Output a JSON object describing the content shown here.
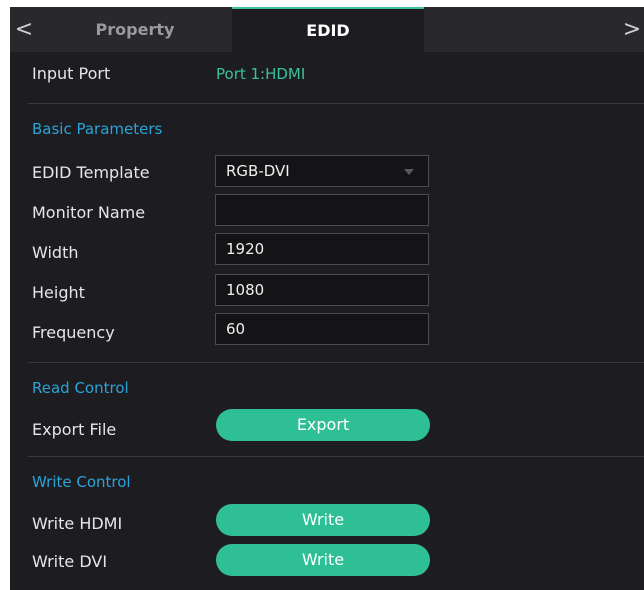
{
  "tabs": {
    "left_arrow": "<",
    "right_arrow": ">",
    "property": "Property",
    "edid": "EDID"
  },
  "input_port": {
    "label": "Input Port",
    "value": "Port 1:HDMI"
  },
  "basic": {
    "title": "Basic Parameters",
    "edid_template": {
      "label": "EDID Template",
      "value": "RGB-DVI"
    },
    "monitor_name": {
      "label": "Monitor Name",
      "value": ""
    },
    "width": {
      "label": "Width",
      "value": "1920"
    },
    "height": {
      "label": "Height",
      "value": "1080"
    },
    "frequency": {
      "label": "Frequency",
      "value": "60"
    }
  },
  "read": {
    "title": "Read Control",
    "export_file": {
      "label": "Export File",
      "button": "Export"
    }
  },
  "write": {
    "title": "Write Control",
    "hdmi": {
      "label": "Write HDMI",
      "button": "Write"
    },
    "dvi": {
      "label": "Write DVI",
      "button": "Write"
    }
  },
  "colors": {
    "accent_green": "#2fbf95",
    "section_blue": "#2aa3d8",
    "background": "#1d1d21"
  }
}
